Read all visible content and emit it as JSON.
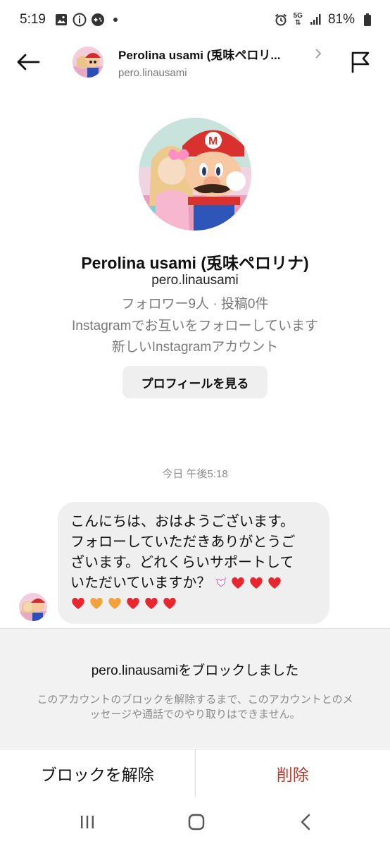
{
  "status_bar": {
    "time": "5:19",
    "network": "5G",
    "battery": "81%"
  },
  "header": {
    "name": "Perolina usami (兎味ペロリ...",
    "username": "pero.linausami"
  },
  "profile": {
    "name": "Perolina usami (兎味ペロリナ)",
    "username": "pero.linausami",
    "stats": "フォロワー9人 · 投稿0件",
    "mutual": "Instagramでお互いをフォローしています",
    "new_account": "新しいInstagramアカウント",
    "view_profile_label": "プロフィールを見る"
  },
  "conversation": {
    "timestamp": "今日 午後5:18",
    "message": {
      "line1": "こんにちは、おはようございます。",
      "line2": "フォローしていただきありがとうご",
      "line3": "ざいます。どれくらいサポートして",
      "line4": "いただいていますか？"
    }
  },
  "blocked": {
    "title": "pero.linausamiをブロックしました",
    "description": "このアカウントのブロックを解除するまで、このアカウントとのメッセージや通話でのやり取りはできません。"
  },
  "actions": {
    "unblock_label": "ブロックを解除",
    "delete_label": "削除"
  },
  "colors": {
    "heart_red": "#e8262e",
    "heart_orange": "#f2a23a",
    "delete_red": "#c0392b",
    "bubble_bg": "#efefef"
  },
  "icons": [
    "back-arrow-icon",
    "flag-icon",
    "chevron-right-icon",
    "recents-icon",
    "home-icon",
    "nav-back-icon"
  ]
}
